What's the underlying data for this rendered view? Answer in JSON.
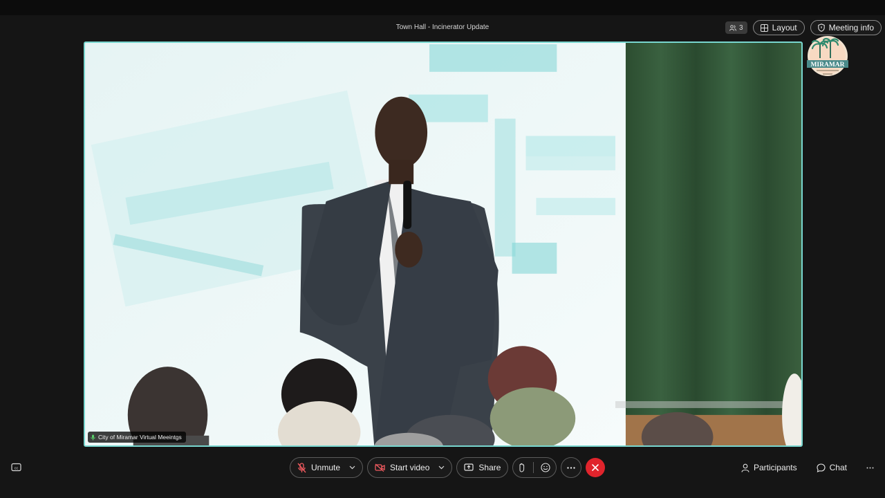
{
  "meeting": {
    "title": "Town Hall - Incinerator Update"
  },
  "header": {
    "participant_count": "3",
    "layout_label": "Layout",
    "meeting_info_label": "Meeting info",
    "logo_text": "MIRAMAR"
  },
  "video": {
    "speaker_name": "City of Miramar Virtual Meeintgs",
    "accent_color": "#78d6cf"
  },
  "controls": {
    "unmute_label": "Unmute",
    "start_video_label": "Start video",
    "share_label": "Share",
    "participants_label": "Participants",
    "chat_label": "Chat"
  },
  "colors": {
    "end_call": "#e0242c",
    "background": "#151515"
  }
}
